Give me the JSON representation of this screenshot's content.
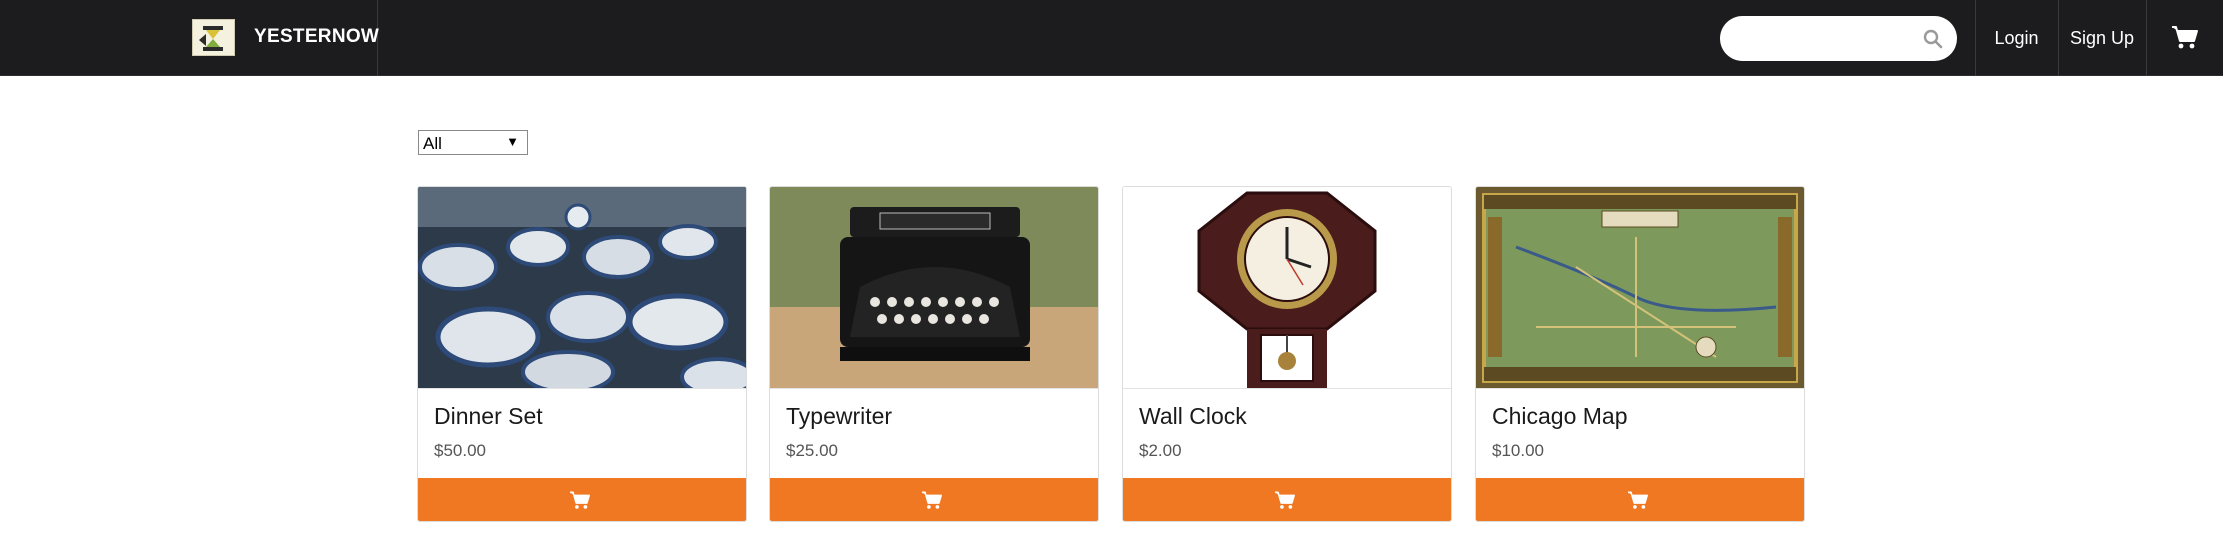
{
  "header": {
    "brand_name": "YESTERNOW",
    "search": {
      "placeholder": "",
      "value": ""
    },
    "nav": {
      "login": "Login",
      "signup": "Sign Up"
    }
  },
  "filter": {
    "selected": "All"
  },
  "products": [
    {
      "title": "Dinner Set",
      "price": "$50.00",
      "image": "dinner-set-photo"
    },
    {
      "title": "Typewriter",
      "price": "$25.00",
      "image": "typewriter-photo"
    },
    {
      "title": "Wall Clock",
      "price": "$2.00",
      "image": "wall-clock-photo"
    },
    {
      "title": "Chicago Map",
      "price": "$10.00",
      "image": "chicago-map-photo"
    }
  ],
  "colors": {
    "navbar": "#1c1c1e",
    "accent": "#f07822"
  },
  "icons": {
    "search": "search-icon",
    "cart": "cart-icon"
  }
}
